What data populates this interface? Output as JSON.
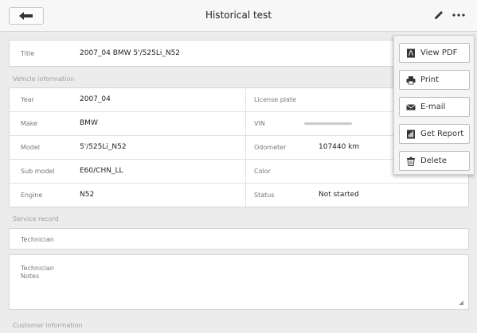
{
  "header": {
    "title": "Historical test",
    "back_icon": "back-arrow-icon",
    "edit_icon": "pencil-icon",
    "more_icon": "more-dots-icon"
  },
  "title_field": {
    "label": "Title",
    "value": "2007_04 BMW 5'/525Li_N52"
  },
  "vehicle_section_label": "Vehicle information",
  "vehicle": [
    {
      "left_label": "Year",
      "left_value": "2007_04",
      "right_label": "License plate",
      "right_value": ""
    },
    {
      "left_label": "Make",
      "left_value": "BMW",
      "right_label": "VIN",
      "right_value": ""
    },
    {
      "left_label": "Model",
      "left_value": "5'/525Li_N52",
      "right_label": "Odometer",
      "right_value": "107440 km"
    },
    {
      "left_label": "Sub model",
      "left_value": "E60/CHN_LL",
      "right_label": "Color",
      "right_value": ""
    },
    {
      "left_label": "Engine",
      "left_value": "N52",
      "right_label": "Status",
      "right_value": "Not started"
    }
  ],
  "service_section_label": "Service record",
  "technician_label": "Technician",
  "technician_notes_label": "Technician\nNotes",
  "customer_section_label": "Customer information",
  "menu": {
    "items": [
      {
        "label": "View PDF",
        "icon": "pdf-icon"
      },
      {
        "label": "Print",
        "icon": "printer-icon"
      },
      {
        "label": "E-mail",
        "icon": "envelope-icon"
      },
      {
        "label": "Get Report",
        "icon": "report-icon"
      },
      {
        "label": "Delete",
        "icon": "trash-icon"
      }
    ]
  }
}
